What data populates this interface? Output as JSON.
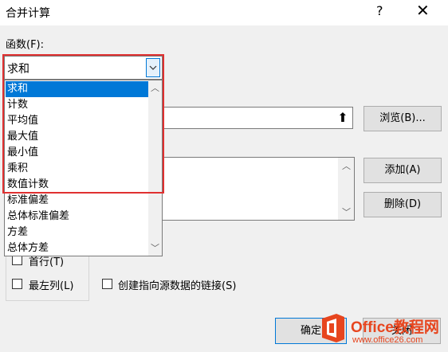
{
  "dialog": {
    "title": "合并计算",
    "help_icon": "?",
    "close_icon": "X"
  },
  "function_label": "函数(F):",
  "function_select": {
    "value": "求和",
    "options": [
      "求和",
      "计数",
      "平均值",
      "最大值",
      "最小值",
      "乘积",
      "数值计数",
      "标准偏差",
      "总体标准偏差",
      "方差",
      "总体方差"
    ],
    "selected_index": 0
  },
  "buttons": {
    "browse": "浏览(B)...",
    "add": "添加(A)",
    "delete": "删除(D)",
    "ok": "确定",
    "close": "关闭"
  },
  "checkboxes": {
    "first_row": "首行(T)",
    "left_column": "最左列(L)",
    "link_source": "创建指向源数据的链接(S)"
  },
  "watermark": {
    "brand": "Office教程网",
    "url": "www.office26.com"
  },
  "colors": {
    "highlight": "#0078d7",
    "red_outline": "#e03030"
  }
}
